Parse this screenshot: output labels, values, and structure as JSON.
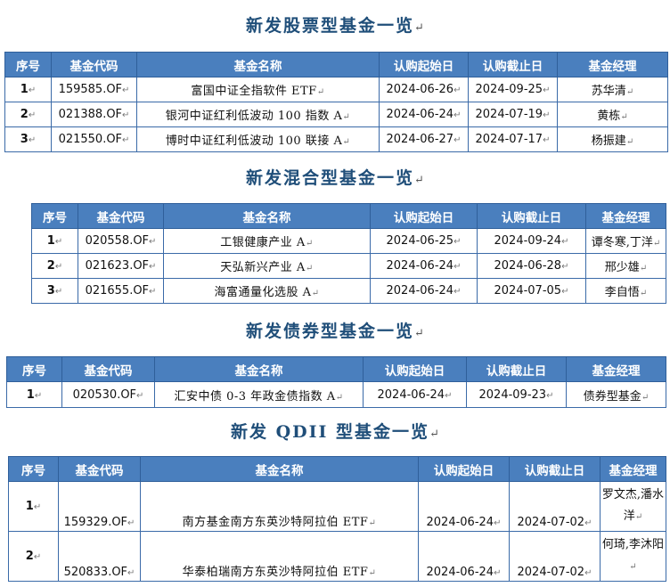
{
  "sections": [
    {
      "title": "新发股票型基金一览",
      "headers": [
        "序号",
        "基金代码",
        "基金名称",
        "认购起始日",
        "认购截止日",
        "基金经理"
      ],
      "rows": [
        {
          "no": "1",
          "code": "159585.OF",
          "name": "富国中证全指软件 ETF",
          "start": "2024-06-26",
          "end": "2024-09-25",
          "manager": "苏华清"
        },
        {
          "no": "2",
          "code": "021388.OF",
          "name": "银河中证红利低波动 100 指数 A",
          "start": "2024-06-24",
          "end": "2024-07-19",
          "manager": "黄栋"
        },
        {
          "no": "3",
          "code": "021550.OF",
          "name": "博时中证红利低波动 100 联接 A",
          "start": "2024-06-27",
          "end": "2024-07-17",
          "manager": "杨振建"
        }
      ]
    },
    {
      "title": "新发混合型基金一览",
      "headers": [
        "序号",
        "基金代码",
        "基金名称",
        "认购起始日",
        "认购截止日",
        "基金经理"
      ],
      "rows": [
        {
          "no": "1",
          "code": "020558.OF",
          "name": "工银健康产业 A",
          "start": "2024-06-25",
          "end": "2024-09-24",
          "manager": "谭冬寒,丁洋"
        },
        {
          "no": "2",
          "code": "021623.OF",
          "name": "天弘新兴产业 A",
          "start": "2024-06-24",
          "end": "2024-06-28",
          "manager": "邢少雄"
        },
        {
          "no": "3",
          "code": "021655.OF",
          "name": "海富通量化选股 A",
          "start": "2024-06-24",
          "end": "2024-07-05",
          "manager": "李自悟"
        }
      ]
    },
    {
      "title": "新发债券型基金一览",
      "headers": [
        "序号",
        "基金代码",
        "基金名称",
        "认购起始日",
        "认购截止日",
        "基金经理"
      ],
      "rows": [
        {
          "no": "1",
          "code": "020530.OF",
          "name": "汇安中债 0-3 年政金债指数 A",
          "start": "2024-06-24",
          "end": "2024-09-23",
          "manager": "债券型基金"
        }
      ]
    },
    {
      "title": "新发 QDII 型基金一览",
      "headers": [
        "序号",
        "基金代码",
        "基金名称",
        "认购起始日",
        "认购截止日",
        "基金经理"
      ],
      "rows": [
        {
          "no": "1",
          "code": "159329.OF",
          "name": "南方基金南方东英沙特阿拉伯 ETF",
          "start": "2024-06-24",
          "end": "2024-07-02",
          "manager": "罗文杰,潘水洋"
        },
        {
          "no": "2",
          "code": "520833.OF",
          "name": "华泰柏瑞南方东英沙特阿拉伯 ETF",
          "start": "2024-06-24",
          "end": "2024-07-02",
          "manager": "何琦,李沐阳"
        }
      ]
    }
  ]
}
